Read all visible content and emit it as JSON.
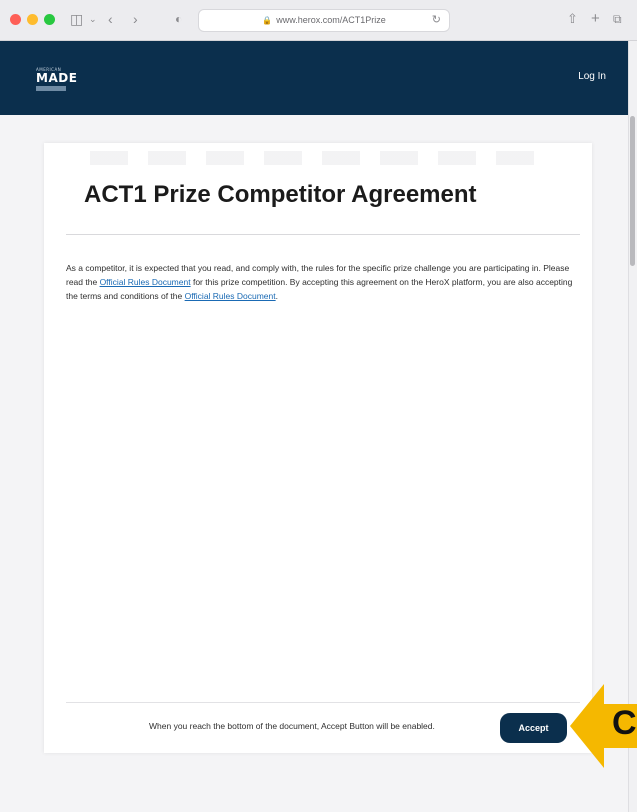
{
  "browser": {
    "url": "www.herox.com/ACT1Prize",
    "controls": [
      "sidebar-icon",
      "chevron-down-icon",
      "back-icon",
      "forward-icon",
      "privacy-shield-icon",
      "reload-icon",
      "share-icon",
      "new-tab-icon",
      "tabs-overview-icon"
    ]
  },
  "header": {
    "logo_small": "AMERICAN",
    "logo_big": "MADE",
    "login_label": "Log In"
  },
  "agreement": {
    "title": "ACT1 Prize Competitor Agreement",
    "body_part1": "As a competitor, it is expected that you read, and comply with, the rules for the specific prize challenge you are participating in.  Please read the ",
    "link1": "Official Rules Document",
    "body_part2": " for this prize competition. By accepting this agreement on the HeroX platform, you are also accepting the terms and conditions of the ",
    "link2": "Official Rules Document",
    "body_part3": ".",
    "bottom_note": "When you reach the bottom of the document, Accept Button will be enabled.",
    "accept_label": "Accept"
  },
  "callout": {
    "letter": "C",
    "color": "#f5b800"
  },
  "colors": {
    "header_bg": "#0b2f4d",
    "link": "#1a6ab4"
  }
}
